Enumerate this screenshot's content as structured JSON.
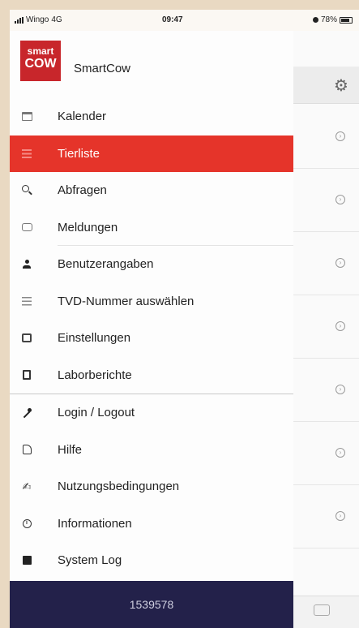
{
  "status_bar": {
    "carrier": "Wingo",
    "network": "4G",
    "time": "09:47",
    "battery": "78%"
  },
  "app": {
    "logo_line1": "smart",
    "logo_line2": "COW",
    "name": "SmartCow"
  },
  "menu": {
    "items": [
      {
        "label": "Kalender",
        "icon": "calendar-icon",
        "active": false
      },
      {
        "label": "Tierliste",
        "icon": "list-icon",
        "active": true
      },
      {
        "label": "Abfragen",
        "icon": "search-icon",
        "active": false
      },
      {
        "label": "Meldungen",
        "icon": "message-icon",
        "active": false
      },
      {
        "label": "Benutzerangaben",
        "icon": "user-icon",
        "active": false
      },
      {
        "label": "TVD-Nummer auswählen",
        "icon": "list-lines-icon",
        "active": false
      },
      {
        "label": "Einstellungen",
        "icon": "settings-icon",
        "active": false
      },
      {
        "label": "Laborberichte",
        "icon": "document-icon",
        "active": false
      },
      {
        "label": "Login / Logout",
        "icon": "key-icon",
        "active": false
      },
      {
        "label": "Hilfe",
        "icon": "help-icon",
        "active": false
      },
      {
        "label": "Nutzungsbedingungen",
        "icon": "terms-icon",
        "active": false
      },
      {
        "label": "Informationen",
        "icon": "info-icon",
        "active": false
      },
      {
        "label": "System Log",
        "icon": "log-icon",
        "active": false
      }
    ]
  },
  "footer": {
    "id_number": "1539578"
  },
  "background_screen": {
    "settings_icon": "gear-icon",
    "row_icon": "chevron-circle-icon",
    "tab_icon": "chat-icon"
  },
  "colors": {
    "accent": "#e5342a",
    "footer_bg": "#23214a",
    "outer_bg": "#e9d9c2",
    "logo_red": "#c8262b"
  }
}
